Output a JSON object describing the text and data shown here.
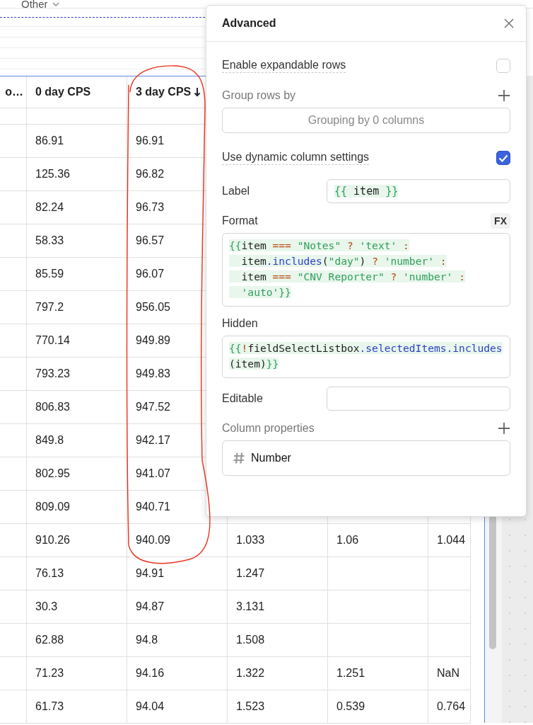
{
  "toolbar": {
    "dropdown": "Other"
  },
  "table": {
    "columns": [
      {
        "label": "o…",
        "sort_descending": false
      },
      {
        "label": "0 day CPS",
        "sort_descending": false
      },
      {
        "label": "3 day CPS",
        "sort_descending": true
      }
    ],
    "rows": [
      {
        "cells": [
          "",
          "86.91",
          "96.91"
        ]
      },
      {
        "cells": [
          "",
          "125.36",
          "96.82"
        ]
      },
      {
        "cells": [
          "",
          "82.24",
          "96.73"
        ]
      },
      {
        "cells": [
          "",
          "58.33",
          "96.57"
        ]
      },
      {
        "cells": [
          "",
          "85.59",
          "96.07"
        ]
      },
      {
        "cells": [
          "",
          "797.2",
          "956.05"
        ]
      },
      {
        "cells": [
          "",
          "770.14",
          "949.89"
        ]
      },
      {
        "cells": [
          "",
          "793.23",
          "949.83"
        ]
      },
      {
        "cells": [
          "",
          "806.83",
          "947.52"
        ]
      },
      {
        "cells": [
          "",
          "849.8",
          "942.17"
        ]
      },
      {
        "cells": [
          "",
          "802.95",
          "941.07"
        ]
      },
      {
        "cells": [
          "",
          "809.09",
          "940.71"
        ]
      },
      {
        "cells": [
          "",
          "910.26",
          "940.09",
          "1.033",
          "1.06",
          "1.044"
        ]
      },
      {
        "cells": [
          "",
          "76.13",
          "94.91",
          "1.247"
        ]
      },
      {
        "cells": [
          "",
          "30.3",
          "94.87",
          "3.131"
        ]
      },
      {
        "cells": [
          "",
          "62.88",
          "94.8",
          "1.508"
        ]
      },
      {
        "cells": [
          "",
          "71.23",
          "94.16",
          "1.322",
          "1.251",
          "NaN"
        ]
      },
      {
        "cells": [
          "",
          "61.73",
          "94.04",
          "1.523",
          "0.539",
          "0.764"
        ]
      }
    ]
  },
  "panel": {
    "title": "Advanced",
    "settings": [
      {
        "kind": "checkbox",
        "label": "Enable expandable rows",
        "checked": false
      },
      {
        "kind": "group",
        "label": "Group rows by",
        "value": "Grouping by 0 columns"
      },
      {
        "kind": "checkbox",
        "label": "Use dynamic column settings",
        "checked": true
      },
      {
        "kind": "inline",
        "label": "Label",
        "tokens": [
          {
            "kind": "brace",
            "text": "{{"
          },
          {
            "kind": "plain",
            "text": " item "
          },
          {
            "kind": "brace",
            "text": "}}"
          }
        ]
      },
      {
        "kind": "code",
        "label": "Format",
        "badge": "FX",
        "lines": [
          [
            {
              "kind": "brace",
              "text": "{{"
            },
            {
              "kind": "plain",
              "text": "item "
            },
            {
              "kind": "operator",
              "text": "=== "
            },
            {
              "kind": "string",
              "text": "\"Notes\" "
            },
            {
              "kind": "operator",
              "text": "? "
            },
            {
              "kind": "string",
              "text": "'text' "
            },
            {
              "kind": "operator",
              "text": ":"
            }
          ],
          [
            {
              "kind": "plain",
              "text": "  item"
            },
            {
              "kind": "method",
              "text": ".includes"
            },
            {
              "kind": "plain",
              "text": "("
            },
            {
              "kind": "string",
              "text": "\"day\""
            },
            {
              "kind": "plain",
              "text": ") "
            },
            {
              "kind": "operator",
              "text": "? "
            },
            {
              "kind": "string",
              "text": "'number' "
            },
            {
              "kind": "operator",
              "text": ":"
            }
          ],
          [
            {
              "kind": "plain",
              "text": "  item "
            },
            {
              "kind": "operator",
              "text": "=== "
            },
            {
              "kind": "string",
              "text": "\"CNV Reporter\" "
            },
            {
              "kind": "operator",
              "text": "? "
            },
            {
              "kind": "string",
              "text": "'number' "
            },
            {
              "kind": "operator",
              "text": ":"
            }
          ],
          [
            {
              "kind": "string",
              "text": "  'auto'"
            },
            {
              "kind": "brace",
              "text": "}}"
            }
          ]
        ]
      },
      {
        "kind": "code",
        "label": "Hidden",
        "lines": [
          [
            {
              "kind": "brace",
              "text": "{{"
            },
            {
              "kind": "operator",
              "text": "!"
            },
            {
              "kind": "plain",
              "text": "fieldSelectListbox"
            },
            {
              "kind": "method",
              "text": ".selectedItems.includes"
            },
            {
              "kind": "plain",
              "text": "(item)"
            },
            {
              "kind": "brace",
              "text": "}}"
            }
          ]
        ]
      },
      {
        "kind": "inline",
        "label": "Editable"
      },
      {
        "kind": "properties",
        "label": "Column properties",
        "items": [
          {
            "kind": "number",
            "label": "Number"
          }
        ]
      }
    ]
  }
}
